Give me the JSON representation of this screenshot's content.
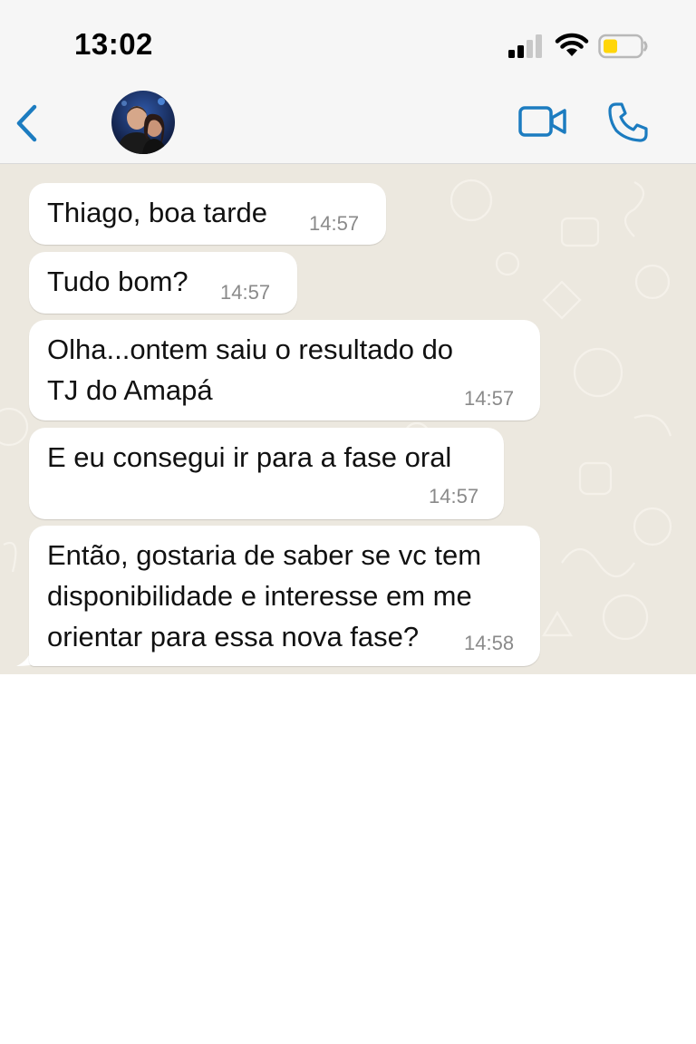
{
  "status_bar": {
    "time": "13:02",
    "icons": [
      "signal-icon",
      "wifi-icon",
      "battery-icon"
    ],
    "battery_color": "#ffd60a"
  },
  "header": {
    "back_icon": "chevron-left-icon",
    "contact_name": "",
    "actions": [
      "video-camera-icon",
      "phone-icon"
    ],
    "accent_color": "#1c7cc0"
  },
  "chat": {
    "wallpaper_color": "#ece8df",
    "bubble_color": "#ffffff",
    "messages": [
      {
        "text": "Thiago, boa tarde",
        "time": "14:57"
      },
      {
        "text": "Tudo bom?",
        "time": "14:57"
      },
      {
        "text": "Olha...ontem saiu o resultado do\nTJ do Amapá",
        "time": "14:57"
      },
      {
        "text": "E eu consegui ir para a fase oral",
        "time": "14:57"
      },
      {
        "text": "Então, gostaria de saber se vc tem\ndisponibilidade e interesse em me\norientar para essa nova fase?",
        "time": "14:58"
      }
    ]
  }
}
